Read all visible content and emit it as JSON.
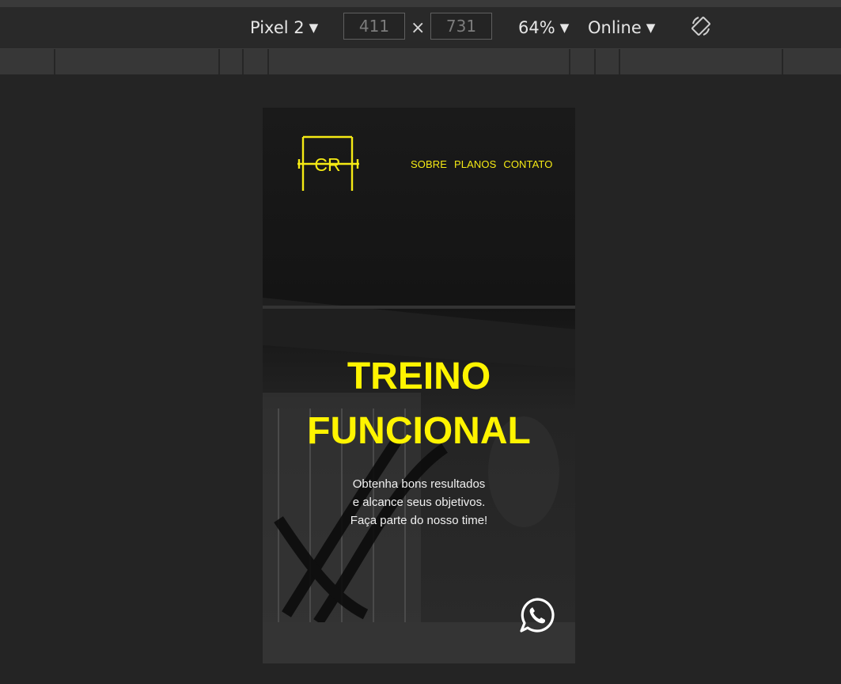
{
  "devtools": {
    "device": "Pixel 2",
    "width": "411",
    "height": "731",
    "times": "×",
    "zoom": "64%",
    "network": "Online",
    "caret": "▼",
    "rotate_icon": "rotate-icon"
  },
  "site": {
    "logo_text": "CR",
    "nav": [
      "SOBRE",
      "PLANOS",
      "CONTATO"
    ],
    "hero_title_line1": "TREINO",
    "hero_title_line2": "FUNCIONAL",
    "hero_sub": [
      "Obtenha bons resultados",
      "e alcance seus objetivos.",
      "Faça parte do nosso time!"
    ],
    "whatsapp_icon": "whatsapp-icon",
    "accent_color": "#fff400"
  }
}
